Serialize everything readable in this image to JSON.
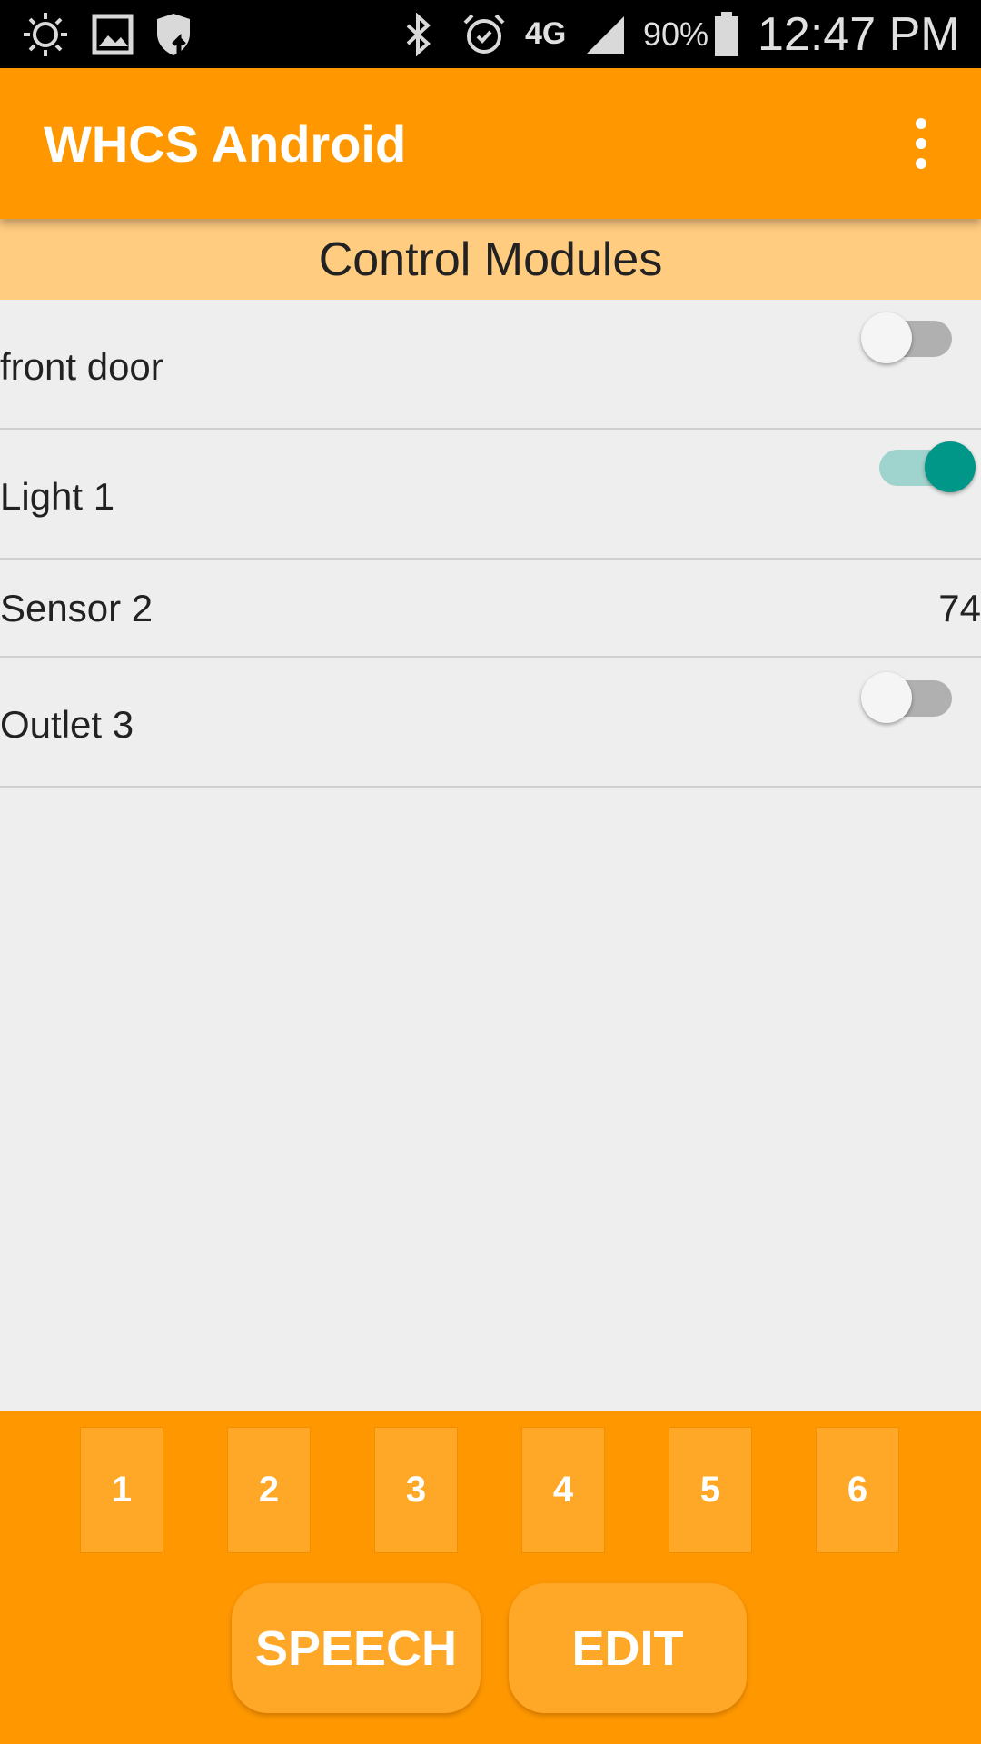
{
  "status_bar": {
    "battery": "90%",
    "time": "12:47 PM",
    "network": "4G",
    "icons": [
      "brightness-icon",
      "image-icon",
      "shield-sync-icon",
      "bluetooth-icon",
      "alarm-icon",
      "4g-lte-icon",
      "signal-icon",
      "battery-icon"
    ]
  },
  "app_bar": {
    "title": "WHCS Android",
    "overflow_icon": "more-vert-icon"
  },
  "section": {
    "title": "Control Modules"
  },
  "modules": [
    {
      "name": "front door",
      "type": "switch",
      "on": false
    },
    {
      "name": "Light 1",
      "type": "switch",
      "on": true
    },
    {
      "name": "Sensor 2",
      "type": "value",
      "value": "74"
    },
    {
      "name": "Outlet 3",
      "type": "switch",
      "on": false
    }
  ],
  "number_buttons": [
    "1",
    "2",
    "3",
    "4",
    "5",
    "6"
  ],
  "actions": {
    "speech": "SPEECH",
    "edit": "EDIT"
  },
  "colors": {
    "primary": "#ff9800",
    "header_tint": "#ffcc80",
    "button": "#ffa726",
    "switch_on": "#009688"
  }
}
